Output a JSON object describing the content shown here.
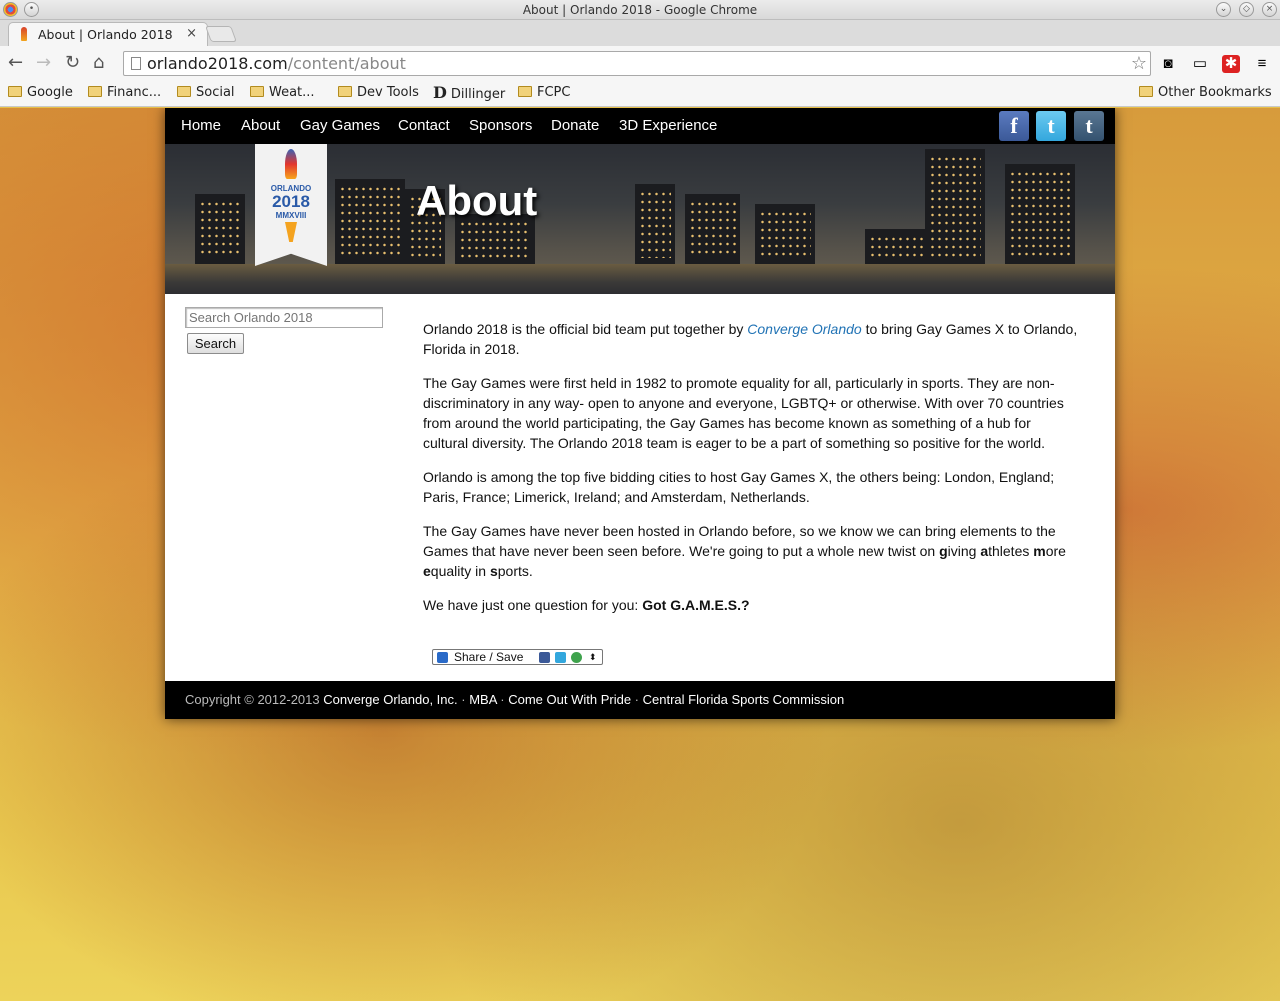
{
  "window": {
    "title": "About | Orlando 2018 - Google Chrome"
  },
  "tab": {
    "title": "About | Orlando 2018",
    "close": "×"
  },
  "address": {
    "host": "orlando2018.com",
    "path": "/content/about"
  },
  "bookmarks": {
    "items": [
      "Google",
      "Financ...",
      "Social",
      "Weat...",
      "Dev Tools",
      "Dillinger",
      "FCPC"
    ],
    "other": "Other Bookmarks"
  },
  "nav": {
    "items": [
      "Home",
      "About",
      "Gay Games",
      "Contact",
      "Sponsors",
      "Donate",
      "3D Experience"
    ],
    "social": [
      "f",
      "t",
      "t"
    ]
  },
  "banner": {
    "title": "About",
    "logo": {
      "line1": "ORLANDO",
      "line2": "2018",
      "line3": "MMXVIII"
    }
  },
  "search": {
    "placeholder": "Search Orlando 2018",
    "button": "Search"
  },
  "content": {
    "p1_before": "Orlando 2018 is the official bid team put together by ",
    "p1_link": "Converge Orlando",
    "p1_after": " to bring Gay Games X to Orlando, Florida in 2018.",
    "p2": "The Gay Games were first held in 1982 to promote equality for all, particularly in sports. They are non-discriminatory in any way- open to anyone and everyone, LGBTQ+ or otherwise. With over 70 countries from around the world participating, the Gay Games has become known as something of a hub for cultural diversity. The Orlando 2018 team is eager to be a part of something so positive for the world.",
    "p3": "Orlando is among the top five bidding cities to host Gay Games X, the others being: London, England; Paris, France; Limerick, Ireland; and Amsterdam, Netherlands.",
    "p4_start": "The Gay Games have never been hosted in Orlando before, so we know we can bring elements to the Games that have never been seen before. We're going to put a whole new twist on ",
    "p4_g": "g",
    "p4_iving": "iving ",
    "p4_a": "a",
    "p4_thletes": "thletes",
    "p4_m": "m",
    "p4_ore": "ore ",
    "p4_e": "e",
    "p4_quality": "quality in ",
    "p4_s": "s",
    "p4_ports": "ports.",
    "p5_before": "We have just one question for you: ",
    "p5_bold": "Got G.A.M.E.S.?",
    "share": "Share / Save"
  },
  "footer": {
    "copyright": "Copyright © 2012-2013 ",
    "org": "Converge Orlando, Inc.",
    "sep": " · ",
    "link1": "MBA",
    "link2": "Come Out With Pride",
    "link3": "Central Florida Sports Commission"
  },
  "colors": {
    "link": "#2173b5",
    "nav_bg": "#000000",
    "facebook": "#3b5998",
    "twitter": "#33a7dd",
    "tumblr": "#34526f"
  }
}
